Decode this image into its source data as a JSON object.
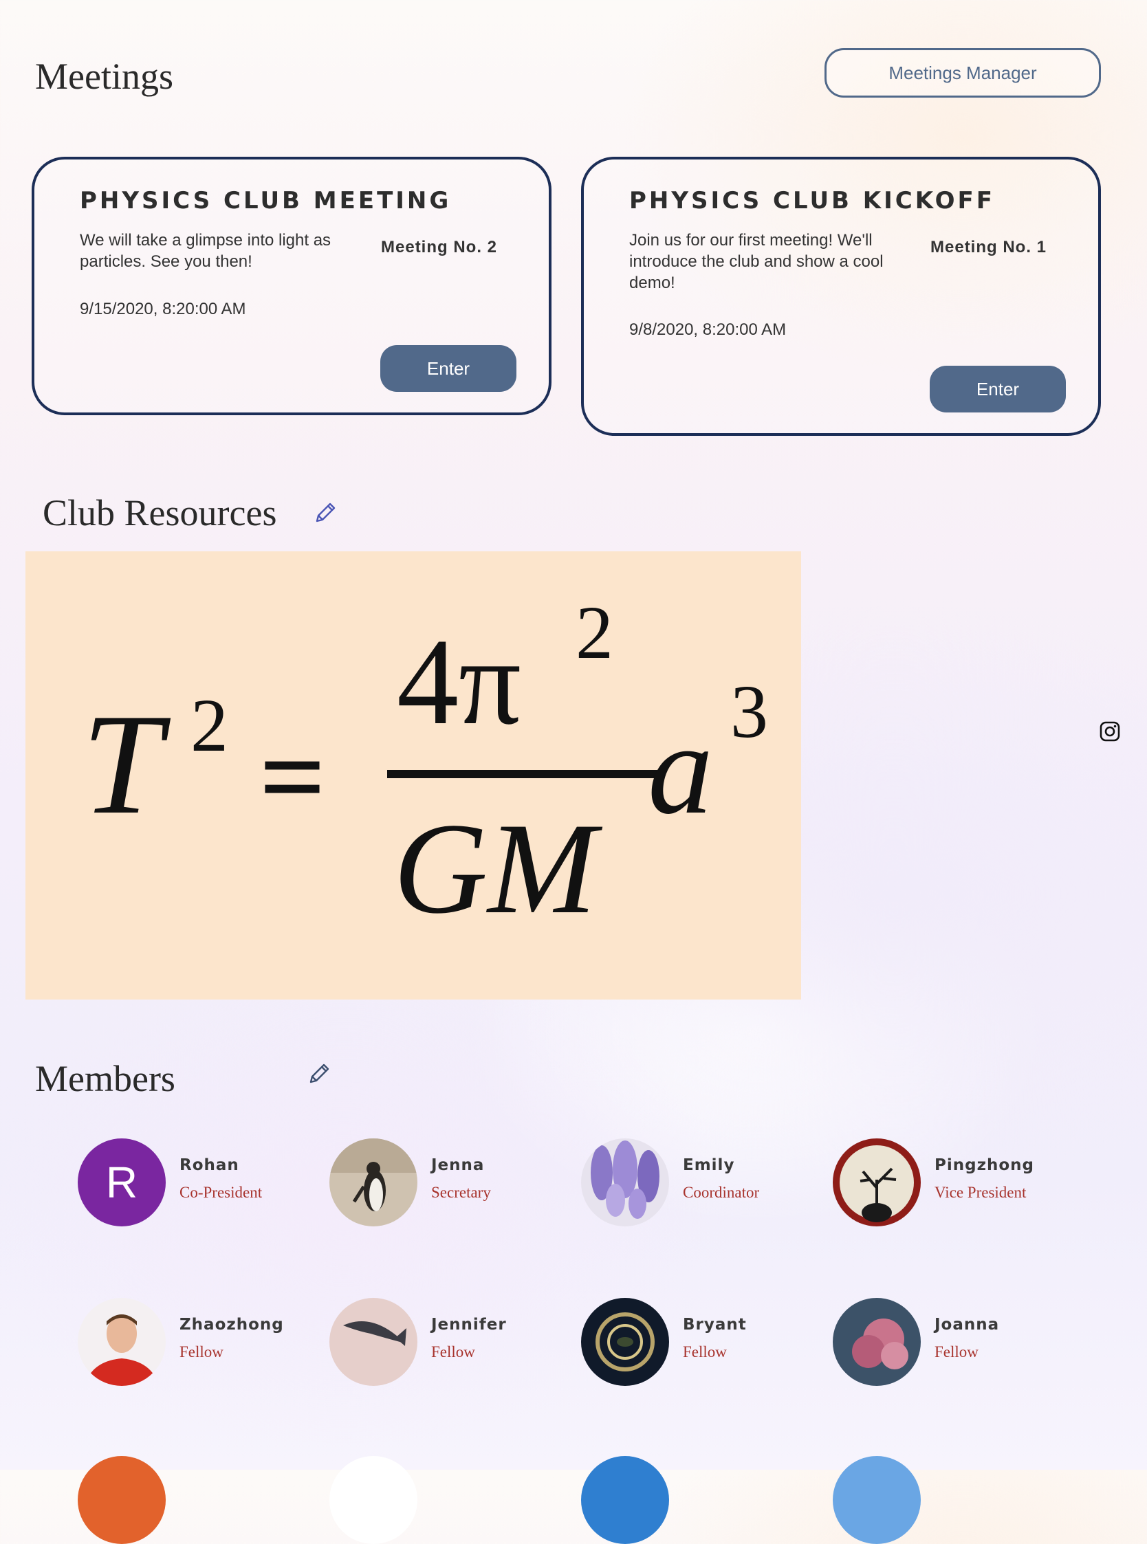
{
  "meetings": {
    "title": "Meetings",
    "manager_button": "Meetings Manager",
    "cards": [
      {
        "title": "PHYSICS CLUB MEETING",
        "description": "We will take a glimpse into light as particles. See you then!",
        "number": "Meeting No. 2",
        "datetime": "9/15/2020, 8:20:00 AM",
        "button": "Enter"
      },
      {
        "title": "PHYSICS CLUB KICKOFF",
        "description": "Join us for our first meeting! We'll introduce the club and show a cool demo!",
        "number": "Meeting No. 1",
        "datetime": "9/8/2020, 8:20:00 AM",
        "button": "Enter"
      }
    ]
  },
  "resources": {
    "title": "Club Resources",
    "formula": {
      "lhs": "T",
      "lhs_exp": "2",
      "eq": "=",
      "numerator": "4π",
      "numerator_exp": "2",
      "denominator": "GM",
      "rhs": "a",
      "rhs_exp": "3"
    }
  },
  "members": {
    "title": "Members",
    "list": [
      {
        "name": "Rohan",
        "role": "Co-President",
        "initial": "R"
      },
      {
        "name": "Jenna",
        "role": "Secretary"
      },
      {
        "name": "Emily",
        "role": "Coordinator"
      },
      {
        "name": "Pingzhong",
        "role": "Vice President"
      },
      {
        "name": "Zhaozhong",
        "role": "Fellow"
      },
      {
        "name": "Jennifer",
        "role": "Fellow"
      },
      {
        "name": "Bryant",
        "role": "Fellow"
      },
      {
        "name": "Joanna",
        "role": "Fellow"
      }
    ]
  },
  "colors": {
    "accent": "#51698a",
    "card_border": "#1c2e57",
    "role_text": "#a8342e",
    "rohan_avatar": "#7a26a0",
    "resource_bg": "#fce5cc"
  },
  "icons": {
    "edit": "pencil-icon",
    "social": "instagram-icon"
  }
}
